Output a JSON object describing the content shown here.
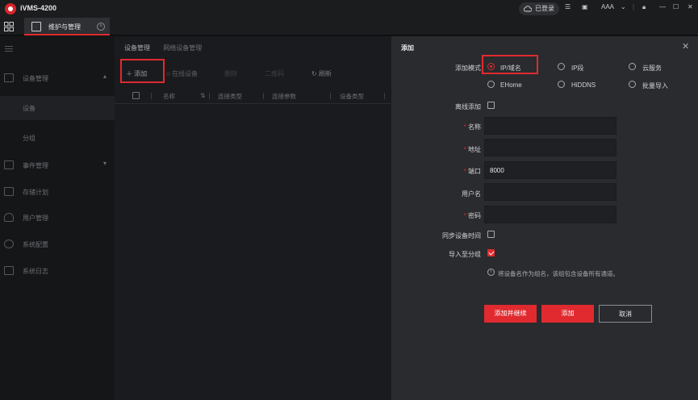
{
  "app": {
    "title": "iVMS-4200"
  },
  "titlebar": {
    "login_label": "已登录",
    "user_label": "AAA"
  },
  "tabs": [
    {
      "label": "维护与管理"
    }
  ],
  "sidebar": {
    "items": [
      {
        "label": "设备管理"
      },
      {
        "label": "设备"
      },
      {
        "label": "分组"
      },
      {
        "label": "事件管理"
      },
      {
        "label": "存储计划"
      },
      {
        "label": "用户管理"
      },
      {
        "label": "系统配置"
      },
      {
        "label": "系统日志"
      }
    ]
  },
  "main": {
    "tabs": [
      {
        "label": "设备管理"
      },
      {
        "label": "网络设备管理"
      }
    ],
    "toolbar": {
      "add": "添加",
      "online": "在线设备",
      "delete": "删除",
      "qr": "二维码",
      "refresh": "刷新"
    },
    "table": {
      "columns": [
        "名称",
        "连接类型",
        "连接参数",
        "设备类型"
      ]
    }
  },
  "dialog": {
    "title": "添加",
    "add_mode_label": "添加模式",
    "modes": [
      {
        "label": "IP/域名",
        "selected": true
      },
      {
        "label": "IP段",
        "selected": false
      },
      {
        "label": "云服务",
        "selected": false
      },
      {
        "label": "EHome",
        "selected": false
      },
      {
        "label": "HiDDNS",
        "selected": false
      },
      {
        "label": "批量导入",
        "selected": false
      }
    ],
    "offline_add_label": "离线添加",
    "fields": {
      "name_label": "名称",
      "address_label": "地址",
      "port_label": "端口",
      "port_value": "8000",
      "username_label": "用户名",
      "password_label": "密码"
    },
    "sync_time_label": "同步设备时间",
    "import_group_label": "导入至分组",
    "hint": "将设备名作为组名，该组包含设备所有通道。",
    "buttons": {
      "add_continue": "添加并继续",
      "add": "添加",
      "cancel": "取消"
    }
  }
}
